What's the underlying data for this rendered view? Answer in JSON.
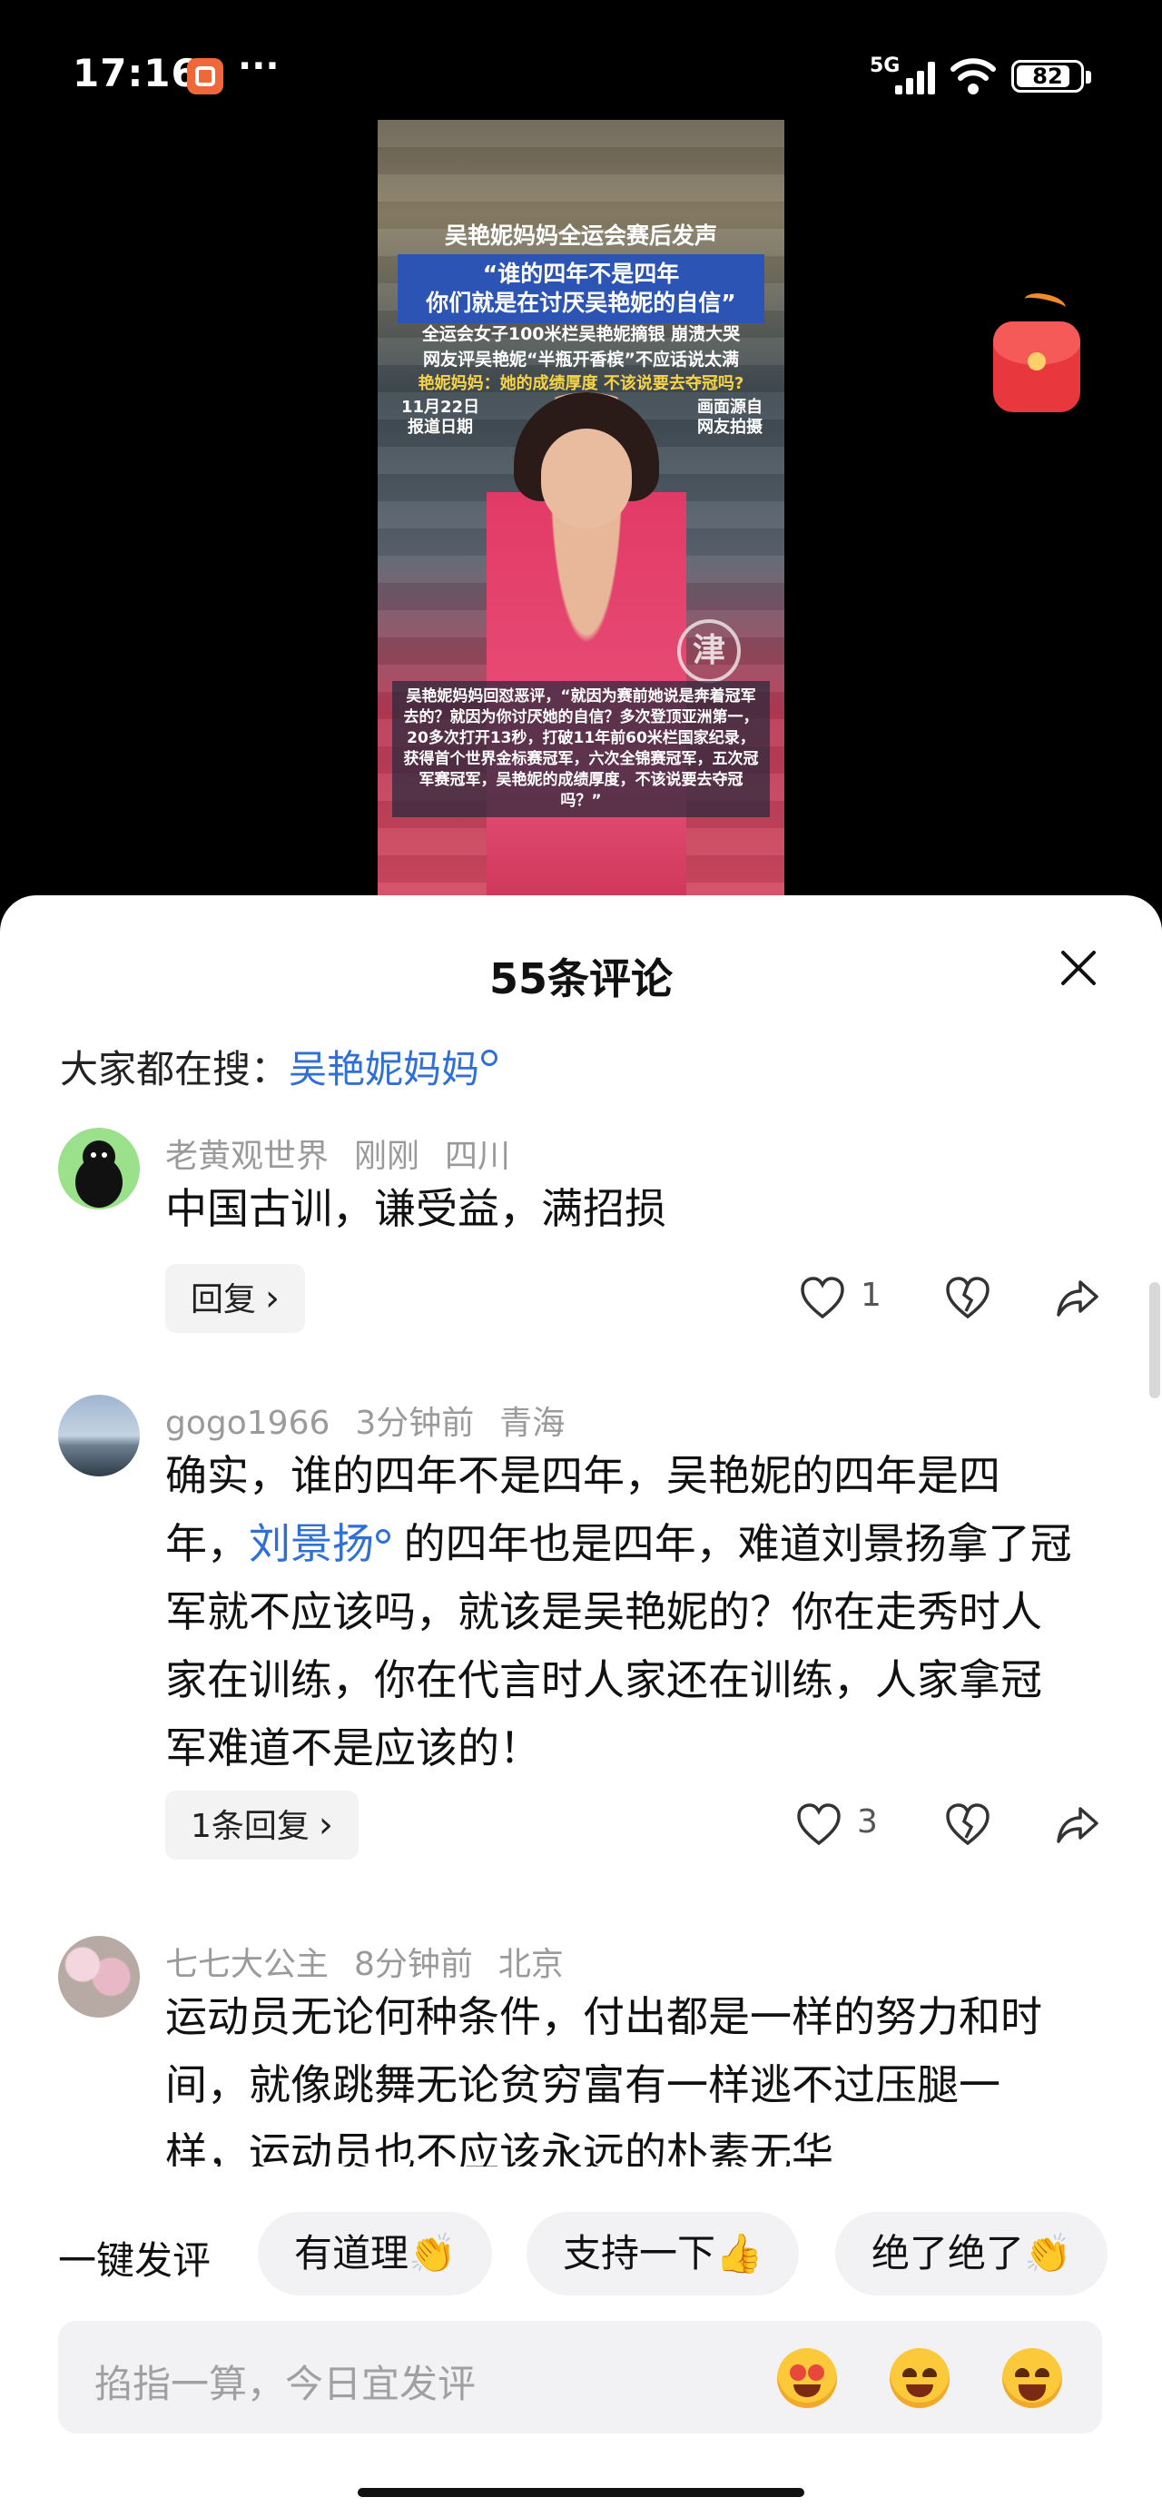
{
  "status": {
    "time": "17:16",
    "network": "5G",
    "battery": "82"
  },
  "video": {
    "title": "吴艳妮妈妈全运会赛后发声",
    "quote_line1": "“谁的四年不是四年",
    "quote_line2": "你们就是在讨厌吴艳妮的自信”",
    "sub_line1": "全运会女子100米栏吴艳妮摘银 崩溃大哭",
    "sub_line2": "网友评吴艳妮“半瓶开香槟”不应话说太满",
    "yellow_line": "艳妮妈妈：她的成绩厚度 不该说要去夺冠吗?",
    "date_line1": "11月22日",
    "date_line2": "报道日期",
    "source_line1": "画面源自",
    "source_line2": "网友拍摄",
    "logo": "津",
    "caption": "吴艳妮妈妈回怼恶评，“就因为赛前她说是奔着冠军去的？就因为你讨厌她的自信？多次登顶亚洲第一，20多次打开13秒，打破11年前60米栏国家纪录，获得首个世界金标赛冠军，六次全锦赛冠军，五次冠军赛冠军，吴艳妮的成绩厚度，不该说要去夺冠吗？”"
  },
  "sheet": {
    "title": "55条评论",
    "search_prefix": "大家都在搜：",
    "search_keyword": "吴艳妮妈妈"
  },
  "comments": [
    {
      "user": "老黄观世界",
      "time": "刚刚",
      "location": "四川",
      "text": "中国古训，谦受益，满招损",
      "reply": "回复",
      "likes": "1"
    },
    {
      "user": "gogo1966",
      "time": "3分钟前",
      "location": "青海",
      "text_part1": "确实，谁的四年不是四年，吴艳妮的四年是四年，",
      "link": "刘景扬",
      "text_part2": "的四年也是四年，难道刘景扬拿了冠军就不应该吗，就该是吴艳妮的？你在走秀时人家在训练，你在代言时人家还在训练，人家拿冠军难道不是应该的！",
      "reply": "1条回复",
      "likes": "3"
    },
    {
      "user": "七七大公主",
      "time": "8分钟前",
      "location": "北京",
      "text": "运动员无论何种条件，付出都是一样的努力和时间，就像跳舞无论贫穷富有一样逃不过压腿一样，运动员也不应该永远的朴素无华"
    }
  ],
  "quick": {
    "label": "一键发评",
    "chips": [
      "有道理👏",
      "支持一下👍",
      "绝了绝了👏"
    ]
  },
  "input": {
    "placeholder": "掐指一算，今日宜发评"
  },
  "icons": {
    "like": "heart-outline-icon",
    "dislike": "broken-heart-icon",
    "share": "share-arrow-icon",
    "close": "close-icon",
    "search_hint": "search-icon"
  }
}
